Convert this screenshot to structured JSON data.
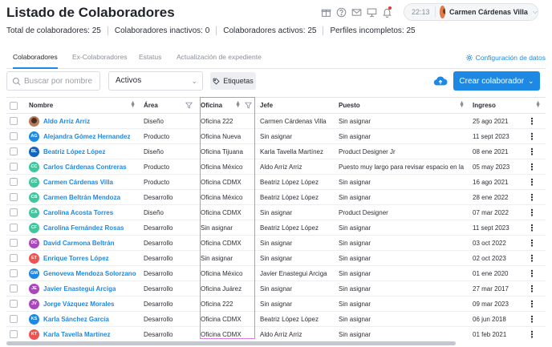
{
  "page": {
    "title": "Listado de Colaboradores"
  },
  "topbar": {
    "icons": [
      "gift-icon",
      "help-icon",
      "mail-icon",
      "presentation-icon",
      "bell-icon"
    ],
    "time": "22:13",
    "user_name": "Carmen Cárdenas Villa"
  },
  "stats": {
    "total": "Total de colaboradores: 25",
    "inactive": "Colaboradores inactivos: 0",
    "active": "Colaboradores activos: 25",
    "incomplete": "Perfiles incompletos: 25"
  },
  "tabs": [
    {
      "label": "Colaboradores",
      "active": true
    },
    {
      "label": "Ex-Colaboradores",
      "active": false
    },
    {
      "label": "Estatus",
      "active": false
    },
    {
      "label": "Actualización de expediente",
      "active": false
    }
  ],
  "config_link": "Configuración de datos",
  "toolbar": {
    "search_placeholder": "Buscar por nombre",
    "status_select": "Activos",
    "tags_label": "Etiquetas",
    "create_label": "Crear colaborador"
  },
  "table": {
    "headers": {
      "name": "Nombre",
      "area": "Área",
      "office": "Oficina",
      "boss": "Jefe",
      "position": "Puesto",
      "start": "Ingreso"
    },
    "rows": [
      {
        "initials": "",
        "photo": true,
        "color": "#b67a5a",
        "name": "Aldo Arriz Arriz",
        "area": "Diseño",
        "office": "Oficina 222",
        "boss": "Carmen Cárdenas Villa",
        "position": "Sin asignar",
        "start": "25 ago 2021"
      },
      {
        "initials": "AG",
        "photo": false,
        "color": "#1e88e5",
        "name": "Alejandra Gómez Hernandez",
        "area": "Producto",
        "office": "Oficina Nueva",
        "boss": "Sin asignar",
        "position": "Sin asignar",
        "start": "11 sept 2023"
      },
      {
        "initials": "BL",
        "photo": false,
        "color": "#1565c0",
        "name": "Beatriz López López",
        "area": "Diseño",
        "office": "Oficina Tijuana",
        "boss": "Karla Tavella Martínez",
        "position": "Product Designer Jr",
        "start": "08 ene 2021"
      },
      {
        "initials": "CC",
        "photo": false,
        "color": "#43c59e",
        "name": "Carlos Cárdenas Contreras",
        "area": "Producto",
        "office": "Oficina México",
        "boss": "Aldo Arriz Arriz",
        "position": "Puesto muy largo para revisar espacio en la",
        "start": "05 may 2023"
      },
      {
        "initials": "CC",
        "photo": false,
        "color": "#43c59e",
        "name": "Carmen Cárdenas Villa",
        "area": "Producto",
        "office": "Oficina CDMX",
        "boss": "Beatriz López López",
        "position": "Sin asignar",
        "start": "16 ago 2021"
      },
      {
        "initials": "CB",
        "photo": false,
        "color": "#43c59e",
        "name": "Carmen Beltrán Mendoza",
        "area": "Desarrollo",
        "office": "Oficina México",
        "boss": "Beatriz López López",
        "position": "Sin asignar",
        "start": "28 ene 2022"
      },
      {
        "initials": "CA",
        "photo": false,
        "color": "#43c59e",
        "name": "Carolina Acosta Torres",
        "area": "Diseño",
        "office": "Oficina CDMX",
        "boss": "Sin asignar",
        "position": "Product Designer",
        "start": "07 mar 2022"
      },
      {
        "initials": "CF",
        "photo": false,
        "color": "#43c59e",
        "name": "Carolina Fernández Rosas",
        "area": "Desarrollo",
        "office": "Sin asignar",
        "boss": "Beatriz López López",
        "position": "Sin asignar",
        "start": "11 sept 2023"
      },
      {
        "initials": "DC",
        "photo": false,
        "color": "#ab47bc",
        "name": "David Carmona Beltrán",
        "area": "Desarrollo",
        "office": "Oficina CDMX",
        "boss": "Sin asignar",
        "position": "Sin asignar",
        "start": "03 oct 2022"
      },
      {
        "initials": "ET",
        "photo": false,
        "color": "#ef5350",
        "name": "Enrique Torres López",
        "area": "Desarrollo",
        "office": "Sin asignar",
        "boss": "Sin asignar",
        "position": "Sin asignar",
        "start": "02 oct 2023"
      },
      {
        "initials": "GM",
        "photo": false,
        "color": "#1e88e5",
        "name": "Genoveva Mendoza Solorzano",
        "area": "Desarrollo",
        "office": "Oficina México",
        "boss": "Javier Enastegui Arciga",
        "position": "Sin asignar",
        "start": "01 ene 2020"
      },
      {
        "initials": "JE",
        "photo": false,
        "color": "#ab47bc",
        "name": "Javier Enastegui Arciga",
        "area": "Desarrollo",
        "office": "Oficina Juárez",
        "boss": "Sin asignar",
        "position": "Sin asignar",
        "start": "27 mar 2017"
      },
      {
        "initials": "JV",
        "photo": false,
        "color": "#ab47bc",
        "name": "Jorge Vázquez Morales",
        "area": "Desarrollo",
        "office": "Oficina 222",
        "boss": "Sin asignar",
        "position": "Sin asignar",
        "start": "09 mar 2023"
      },
      {
        "initials": "KS",
        "photo": false,
        "color": "#1e88e5",
        "name": "Karla Sánchez García",
        "area": "Desarrollo",
        "office": "Oficina CDMX",
        "boss": "Beatriz López López",
        "position": "Sin asignar",
        "start": "06 jun 2018"
      },
      {
        "initials": "KT",
        "photo": false,
        "color": "#ef5350",
        "name": "Karla Tavella Martínez",
        "area": "Desarrollo",
        "office": "Oficina CDMX",
        "boss": "Aldo Arriz Arriz",
        "position": "Sin asignar",
        "start": "01 feb 2021"
      }
    ]
  },
  "colors": {
    "accent": "#1e88e5",
    "highlight_border": "#e07be6"
  }
}
